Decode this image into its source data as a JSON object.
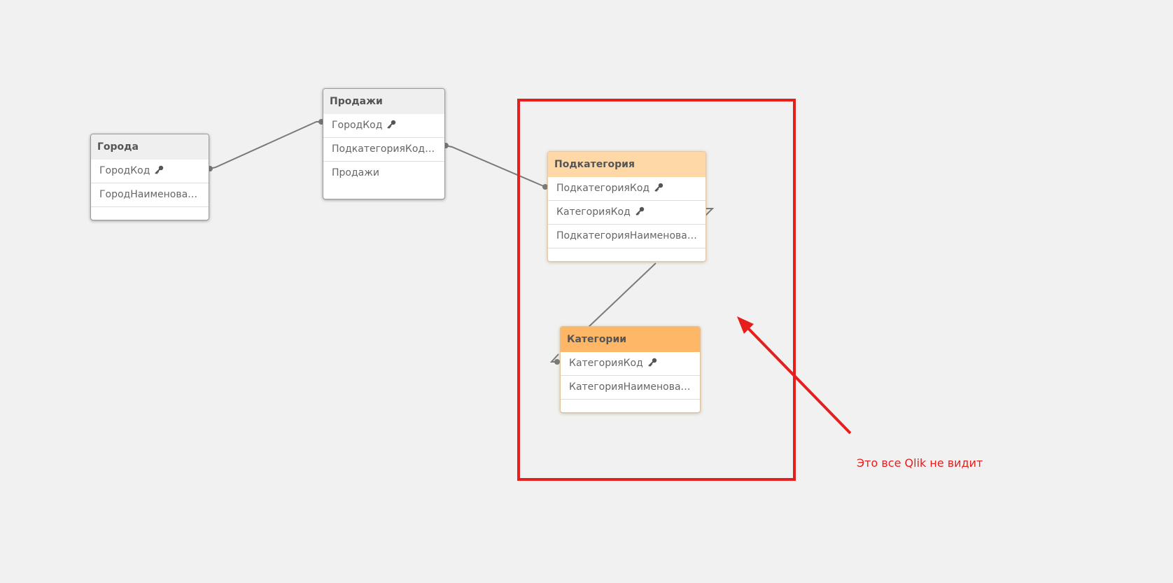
{
  "tables": [
    {
      "name": "Города",
      "fields": [
        {
          "label": "ГородКод",
          "key": true
        },
        {
          "label": "ГородНаименование",
          "key": false
        }
      ]
    },
    {
      "name": "Продажи",
      "fields": [
        {
          "label": "ГородКод",
          "key": true
        },
        {
          "label": "ПодкатегорияКод",
          "key": true
        },
        {
          "label": "Продажи",
          "key": false
        }
      ]
    },
    {
      "name": "Подкатегория",
      "fields": [
        {
          "label": "ПодкатегорияКод",
          "key": true
        },
        {
          "label": "КатегорияКод",
          "key": true
        },
        {
          "label": "ПодкатегорияНаименован…",
          "key": false
        }
      ]
    },
    {
      "name": "Категории",
      "fields": [
        {
          "label": "КатегорияКод",
          "key": true
        },
        {
          "label": "КатегорияНаименование",
          "key": false
        }
      ]
    }
  ],
  "annotation": {
    "text": "Это все Qlik не видит",
    "color": "#e51e1e"
  },
  "colors": {
    "background": "#f1f1f1",
    "link_line": "#7a7a7a",
    "highlight_light": "#fed8a6",
    "highlight_dark": "#fdb766"
  },
  "icons": {
    "key": "key-icon"
  }
}
